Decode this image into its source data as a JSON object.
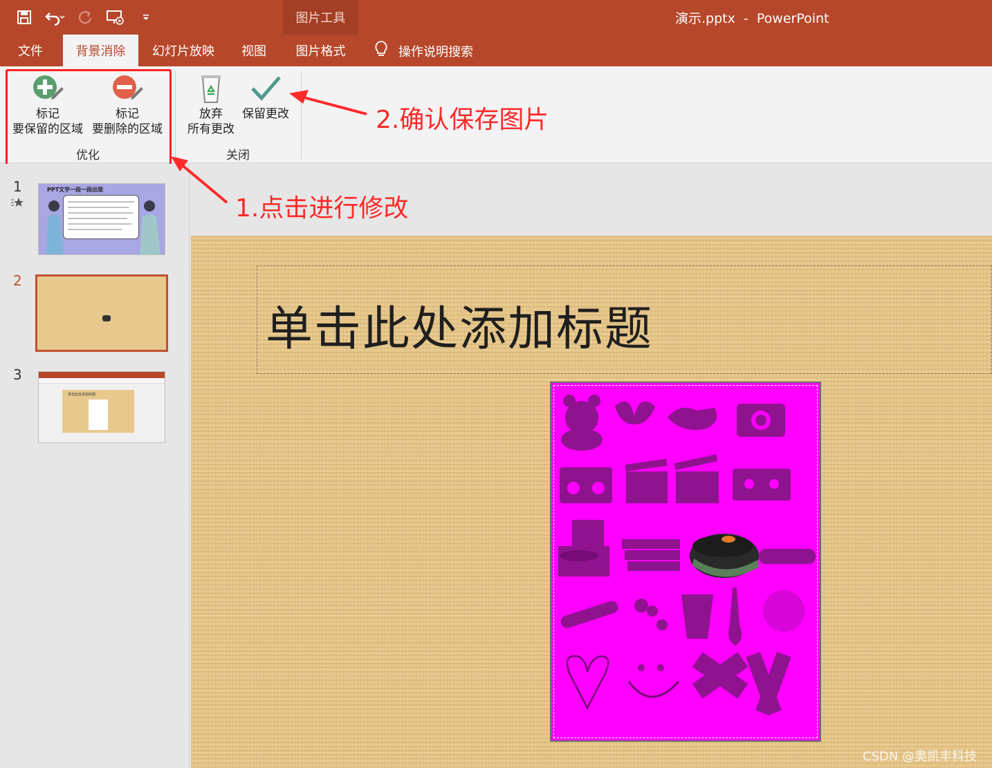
{
  "window": {
    "context_tool": "图片工具",
    "title": "演示.pptx  -  PowerPoint"
  },
  "tabs": [
    {
      "label": "文件"
    },
    {
      "label": "背景消除"
    },
    {
      "label": "幻灯片放映"
    },
    {
      "label": "视图"
    },
    {
      "label": "图片格式"
    }
  ],
  "tell_me": "操作说明搜索",
  "ribbon": {
    "mark_keep": {
      "line1": "标记",
      "line2": "要保留的区域"
    },
    "mark_remove": {
      "line1": "标记",
      "line2": "要删除的区域"
    },
    "refine_group": "优化",
    "discard": {
      "line1": "放弃",
      "line2": "所有更改"
    },
    "keep": {
      "line1": "保留更改"
    },
    "close_group": "关闭"
  },
  "thumbnails": [
    {
      "number": "1",
      "title": "PPT文字一段一段出现"
    },
    {
      "number": "2"
    },
    {
      "number": "3",
      "title": "单击此处添加标题"
    }
  ],
  "slide": {
    "title_placeholder": "单击此处添加标题"
  },
  "annotations": {
    "step1": "1.点击进行修改",
    "step2": "2.确认保存图片"
  },
  "watermark": "CSDN @奥凯丰科技",
  "colors": {
    "accent": "#b7472a",
    "annotation": "#ff2a2a",
    "removed_area": "#ff00ff",
    "slide_bg": "#e8c98d"
  }
}
